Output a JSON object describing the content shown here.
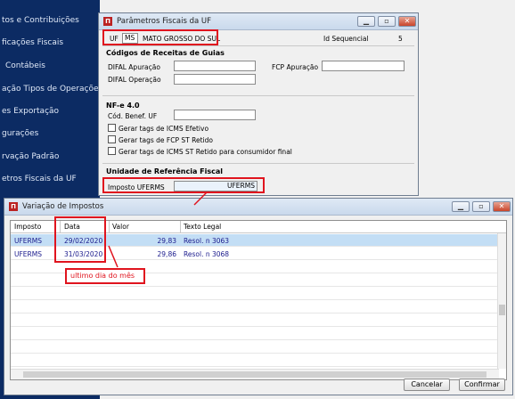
{
  "sidebar": {
    "items": [
      {
        "label": "tos e Contribuições"
      },
      {
        "label": "ficações Fiscais"
      },
      {
        "label": "Contábeis"
      },
      {
        "label": "ação Tipos de Operações"
      },
      {
        "label": "es Exportação"
      },
      {
        "label": "gurações"
      },
      {
        "label": "rvação Padrão"
      },
      {
        "label": "etros Fiscais da UF"
      }
    ]
  },
  "param_window": {
    "title": "Parâmetros Fiscais da UF",
    "buttons": {
      "minimize": "▁",
      "restore": "▫",
      "close": "✕"
    },
    "uf_label": "UF",
    "uf_value": "MS",
    "uf_name": "MATO GROSSO DO SUL",
    "id_label": "Id Sequencial",
    "id_value": "5",
    "guias": {
      "title": "Códigos de Receitas de Guias",
      "difal_apuracao": "DIFAL Apuração",
      "difal_operacao": "DIFAL Operação",
      "fcp_apuracao": "FCP Apuração"
    },
    "nfe": {
      "title": "NF-e 4.0",
      "cod_benef": "Cód. Benef. UF",
      "check1": "Gerar tags de ICMS Efetivo",
      "check2": "Gerar tags de FCP ST Retido",
      "check3": "Gerar tags de ICMS ST Retido para consumidor final"
    },
    "ref": {
      "title": "Unidade de Referência Fiscal",
      "label": "Imposto UFERMS",
      "value": "UFERMS"
    }
  },
  "var_window": {
    "title": "Variação de Impostos",
    "columns": [
      "Imposto",
      "Data",
      "Valor",
      "Texto Legal"
    ],
    "rows": [
      {
        "imposto": "UFERMS",
        "data": "29/02/2020",
        "valor": "29,83",
        "texto": "Resol. n 3063"
      },
      {
        "imposto": "UFERMS",
        "data": "31/03/2020",
        "valor": "29,86",
        "texto": "Resol. n 3068"
      }
    ],
    "annotation": "ultimo dia do mês",
    "cancel_label": "Cancelar",
    "confirm_label": "Confirmar"
  }
}
